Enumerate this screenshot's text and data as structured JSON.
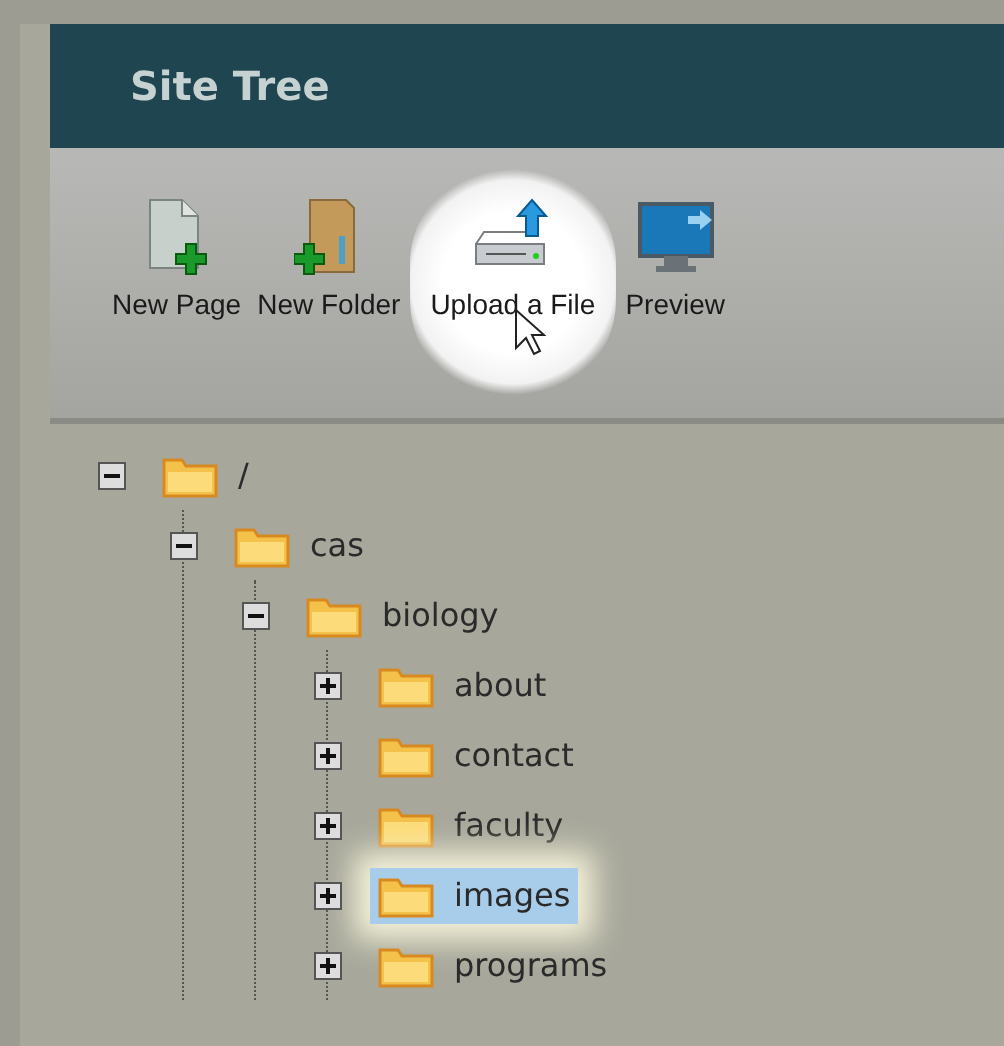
{
  "panel": {
    "title": "Site Tree"
  },
  "toolbar": [
    {
      "kind": "new-page",
      "label": "New Page",
      "highlighted": false
    },
    {
      "kind": "new-folder",
      "label": "New Folder",
      "highlighted": false
    },
    {
      "kind": "upload",
      "label": "Upload a File",
      "highlighted": true
    },
    {
      "kind": "preview",
      "label": "Preview",
      "highlighted": false
    }
  ],
  "tree": [
    {
      "label": "/",
      "expanded": true,
      "selected": false,
      "children": [
        {
          "label": "cas",
          "expanded": true,
          "selected": false,
          "children": [
            {
              "label": "biology",
              "expanded": true,
              "selected": false,
              "children": [
                {
                  "label": "about",
                  "expanded": false,
                  "selected": false
                },
                {
                  "label": "contact",
                  "expanded": false,
                  "selected": false
                },
                {
                  "label": "faculty",
                  "expanded": false,
                  "selected": false
                },
                {
                  "label": "images",
                  "expanded": false,
                  "selected": true
                },
                {
                  "label": "programs",
                  "expanded": false,
                  "selected": false
                }
              ]
            }
          ]
        }
      ]
    }
  ]
}
